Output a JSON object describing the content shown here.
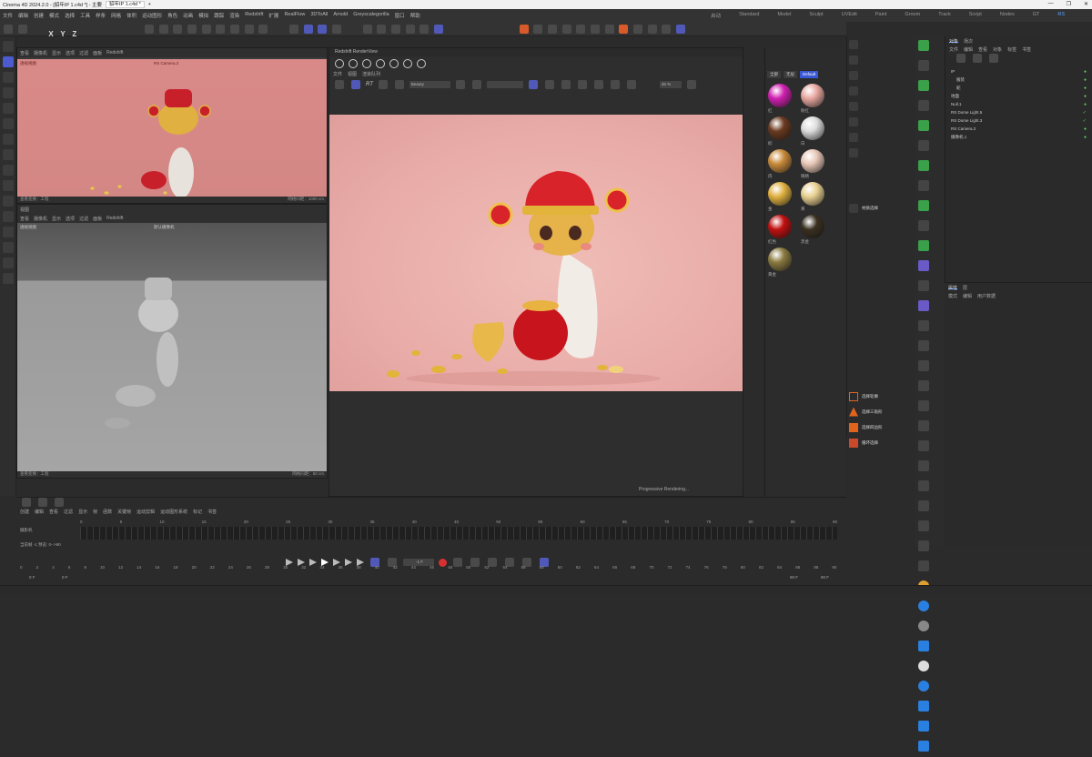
{
  "window": {
    "app_title": "Cinema 4D 2024.2.0 - [貂年IP 1.c4d *] - 主要",
    "tab_label": "貂年IP 1.c4d *",
    "new_tab": "+",
    "controls": [
      "—",
      "❐",
      "✕"
    ]
  },
  "menubar": {
    "items": [
      "文件",
      "编辑",
      "创建",
      "模式",
      "选择",
      "工具",
      "样条",
      "网格",
      "体积",
      "运动图形",
      "角色",
      "动画",
      "模拟",
      "跟踪",
      "渲染",
      "Redshift",
      "扩展",
      "RealFlow",
      "3DToAll",
      "Arnold",
      "Greyscalegorilla",
      "窗口",
      "帮助"
    ],
    "layouts": [
      "启动",
      "Standard",
      "Model",
      "Sculpt",
      "UVEdit",
      "Paint",
      "Groom",
      "Track",
      "Script",
      "Nodes",
      "GT",
      "RS"
    ],
    "active_layout": "RS"
  },
  "toolbar": {
    "axis_letters": [
      "X",
      "Y",
      "Z"
    ]
  },
  "viewport_top": {
    "menu": [
      "查看",
      "摄像机",
      "显示",
      "选项",
      "过滤",
      "面板",
      "Redshift"
    ],
    "camera_label": "透视视图",
    "camera_name": "RS Camera.2",
    "footer_left": "查看变换：工程",
    "footer_right": "网格间距：1000 cm"
  },
  "viewport_bottom": {
    "title": "视图",
    "menu": [
      "查看",
      "摄像机",
      "显示",
      "选项",
      "过滤",
      "面板",
      "Redshift"
    ],
    "camera_label": "透视视图",
    "camera_name": "默认摄像机",
    "footer_left": "查看变换：工程",
    "footer_right": "网格间距：50 cm"
  },
  "renderview": {
    "title": "Redshift RenderView",
    "menu": [
      "文件",
      "视图",
      "渲染队列"
    ],
    "beauty_dropdown": "Beauty",
    "rt_label": "RT",
    "zoom": "45 %",
    "progress_text": "Progressive Rendering..."
  },
  "materials": {
    "tabs": [
      "全部",
      "无层",
      "Default"
    ],
    "active_tab": "Default",
    "items": [
      {
        "name": "红",
        "color": "#d020b0"
      },
      {
        "name": "粉红",
        "color": "#e8a8a0"
      },
      {
        "name": "棕",
        "color": "#6a3a20"
      },
      {
        "name": "白",
        "color": "#dcdcdc"
      },
      {
        "name": "肉",
        "color": "#c88a3a"
      },
      {
        "name": "眼睛",
        "color": "#e8c8b8"
      },
      {
        "name": "金",
        "color": "#e0b040"
      },
      {
        "name": "黄",
        "color": "#e8d090"
      },
      {
        "name": "红色",
        "color": "#c01010"
      },
      {
        "name": "黑金",
        "color": "#3a3020"
      },
      {
        "name": "黄金",
        "color": "#8a7a40"
      }
    ]
  },
  "attributes": {
    "bright_items": [
      "材质选择",
      "选择轮廓",
      "选择三角形",
      "选择四边形",
      "循环选择"
    ]
  },
  "object_manager": {
    "tabs": [
      "对象",
      "场次"
    ],
    "menu": [
      "文件",
      "编辑",
      "查看",
      "对象",
      "标签",
      "书签"
    ],
    "objects": [
      "IP",
      "服装",
      "蛇",
      "地面",
      "Null.1",
      "RS Dome Light.5",
      "RS Dome Light.3",
      "RS Camera.2",
      "摄像机.1"
    ]
  },
  "properties": {
    "tabs": [
      "属性",
      "层"
    ],
    "menu": [
      "模式",
      "编辑",
      "用户数据"
    ]
  },
  "timeline": {
    "menu": [
      "创建",
      "编辑",
      "查看",
      "过滤",
      "显示",
      "帧",
      "函数",
      "关键帧",
      "运动剪辑",
      "运动图形系统",
      "标记",
      "书签"
    ],
    "ruler_ticks": [
      "0",
      "5",
      "10",
      "15",
      "20",
      "25",
      "30",
      "35",
      "40",
      "45",
      "50",
      "55",
      "60",
      "65",
      "70",
      "75",
      "80",
      "85",
      "90"
    ],
    "bottom_ticks": [
      "0",
      "2",
      "4",
      "6",
      "8",
      "10",
      "12",
      "14",
      "16",
      "18",
      "20",
      "22",
      "24",
      "26",
      "28",
      "30",
      "32",
      "34",
      "36",
      "38",
      "40",
      "42",
      "44",
      "46",
      "48",
      "50",
      "52",
      "54",
      "56",
      "58",
      "60",
      "62",
      "64",
      "66",
      "68",
      "70",
      "72",
      "74",
      "76",
      "78",
      "80",
      "82",
      "84",
      "86",
      "88",
      "90"
    ],
    "current_frame": "0 F",
    "start_frame": "0 F",
    "end_frame": "90 F",
    "end_frame2": "90 F",
    "frame_field": "-1 F",
    "track_label": "摄影机",
    "range_label": "当前帧 -1  预览: 0-->90"
  }
}
